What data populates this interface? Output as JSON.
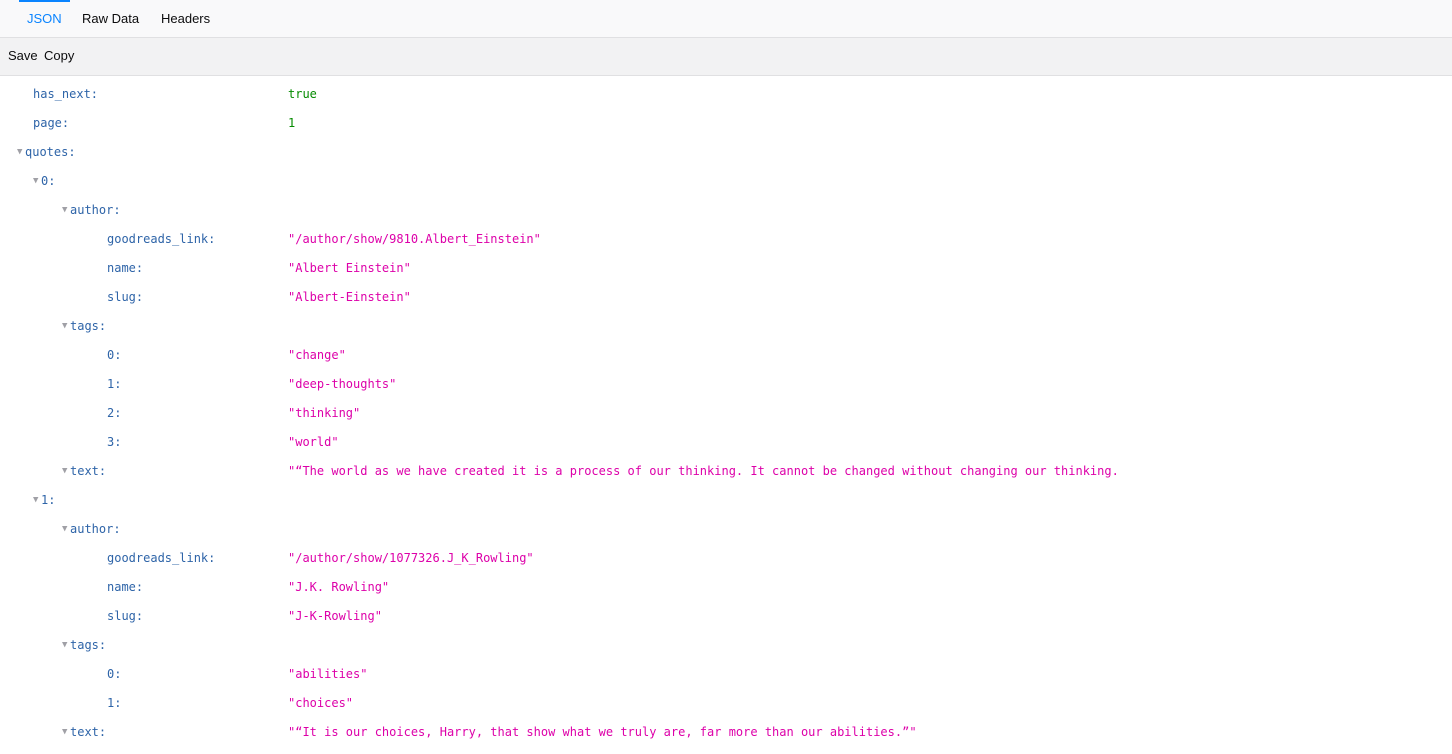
{
  "tabs": {
    "json": "JSON",
    "raw": "Raw Data",
    "headers": "Headers"
  },
  "toolbar": {
    "save": "Save",
    "copy": "Copy"
  },
  "twisty": "▼",
  "tree": {
    "has_next": {
      "key": "has_next:",
      "value": "true"
    },
    "page": {
      "key": "page:",
      "value": "1"
    },
    "quotes_key": "quotes:",
    "quotes": [
      {
        "index_key": "0:",
        "author_key": "author:",
        "goodreads_key": "goodreads_link:",
        "goodreads_link": "\"/author/show/9810.Albert_Einstein\"",
        "name_key": "name:",
        "name": "\"Albert Einstein\"",
        "slug_key": "slug:",
        "slug": "\"Albert-Einstein\"",
        "tags_key": "tags:",
        "tags": [
          {
            "key": "0:",
            "value": "\"change\""
          },
          {
            "key": "1:",
            "value": "\"deep-thoughts\""
          },
          {
            "key": "2:",
            "value": "\"thinking\""
          },
          {
            "key": "3:",
            "value": "\"world\""
          }
        ],
        "text_key": "text:",
        "text": "\"“The world as we have created it is a process of our thinking. It cannot be changed without changing our thinking."
      },
      {
        "index_key": "1:",
        "author_key": "author:",
        "goodreads_key": "goodreads_link:",
        "goodreads_link": "\"/author/show/1077326.J_K_Rowling\"",
        "name_key": "name:",
        "name": "\"J.K. Rowling\"",
        "slug_key": "slug:",
        "slug": "\"J-K-Rowling\"",
        "tags_key": "tags:",
        "tags": [
          {
            "key": "0:",
            "value": "\"abilities\""
          },
          {
            "key": "1:",
            "value": "\"choices\""
          }
        ],
        "text_key": "text:",
        "text": "\"“It is our choices, Harry, that show what we truly are, far more than our abilities.”\""
      }
    ]
  }
}
